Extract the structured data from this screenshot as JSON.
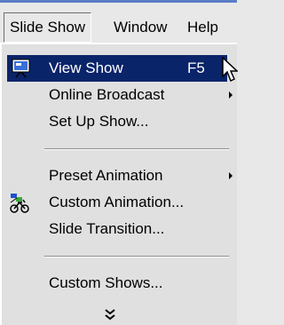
{
  "menubar": {
    "items": [
      {
        "label": "Slide Show",
        "active": true
      },
      {
        "label": "Window",
        "active": false
      },
      {
        "label": "Help",
        "active": false
      }
    ]
  },
  "menu": {
    "items": [
      {
        "label": "View Show",
        "shortcut": "F5",
        "icon": "projector-screen-icon",
        "highlighted": true,
        "submenu": false
      },
      {
        "label": "Online Broadcast",
        "shortcut": "",
        "icon": "",
        "highlighted": false,
        "submenu": true
      },
      {
        "label": "Set Up Show...",
        "shortcut": "",
        "icon": "",
        "highlighted": false,
        "submenu": false
      },
      {
        "label": "Preset Animation",
        "shortcut": "",
        "icon": "",
        "highlighted": false,
        "submenu": true
      },
      {
        "label": "Custom Animation...",
        "shortcut": "",
        "icon": "custom-animation-icon",
        "highlighted": false,
        "submenu": false
      },
      {
        "label": "Slide Transition...",
        "shortcut": "",
        "icon": "",
        "highlighted": false,
        "submenu": false
      },
      {
        "label": "Custom Shows...",
        "shortcut": "",
        "icon": "",
        "highlighted": false,
        "submenu": false
      }
    ],
    "expand_icon": "double-chevron-down-icon"
  },
  "colors": {
    "highlight": "#0a246a",
    "menu_bg": "#e0e0e0",
    "titlebar_accent": "#5a7ec7"
  }
}
